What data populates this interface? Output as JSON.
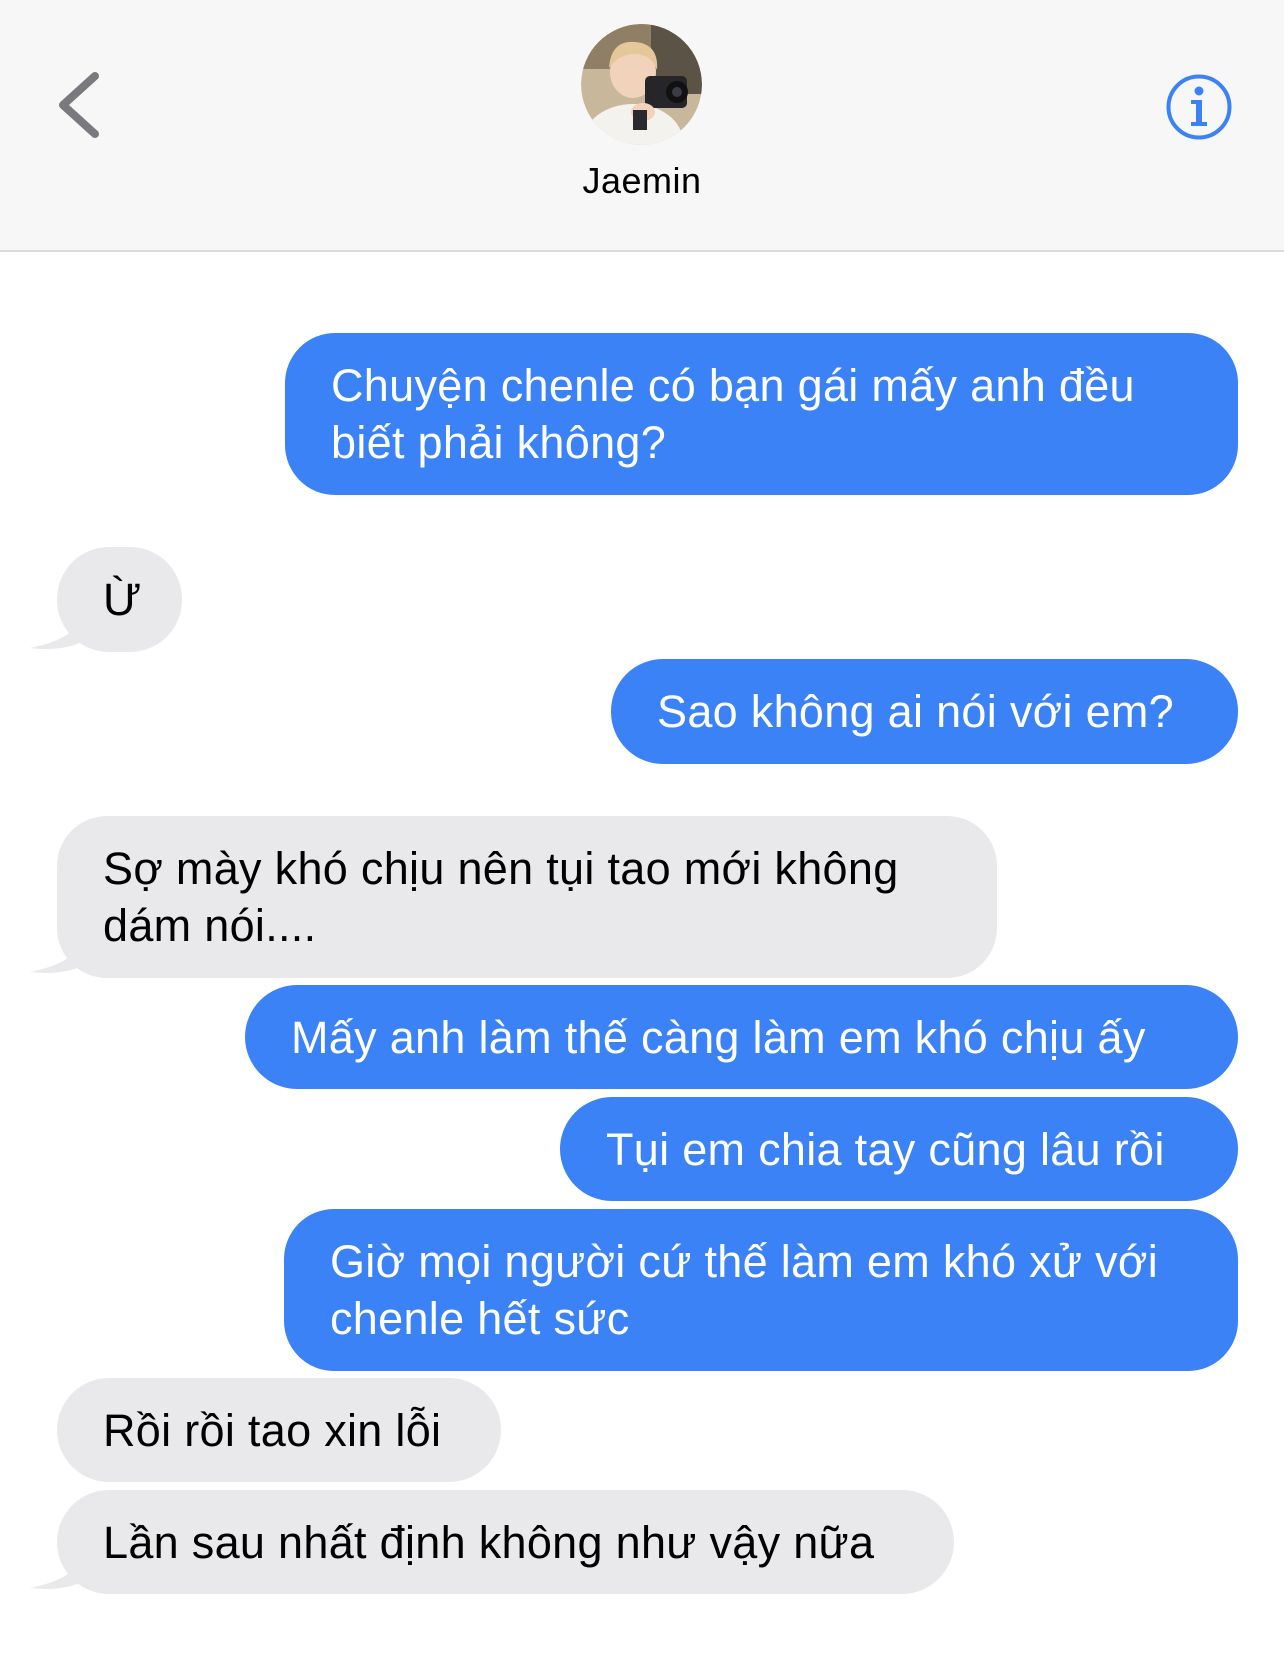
{
  "header": {
    "contact_name": "Jaemin",
    "back_icon": "chevron-left-icon",
    "info_icon": "info-circle-icon",
    "accent_color": "#3a82f6"
  },
  "conversation": {
    "messages": [
      {
        "direction": "sent",
        "text": "Chuyện chenle có bạn gái mấy anh đều\nbiết phải không?"
      },
      {
        "direction": "received",
        "text": "Ừ"
      },
      {
        "direction": "sent",
        "text": "Sao không ai nói với em?"
      },
      {
        "direction": "received",
        "text": "Sợ mày khó chịu nên tụi tao mới không\ndám nói...."
      },
      {
        "direction": "sent",
        "text": "Mấy anh làm thế càng làm em khó chịu ấy"
      },
      {
        "direction": "sent",
        "text": "Tụi em chia tay cũng lâu rồi"
      },
      {
        "direction": "sent",
        "text": "Giờ mọi người cứ thế làm em khó xử với\nchenle hết sức"
      },
      {
        "direction": "received",
        "text": "Rồi rồi tao xin lỗi"
      },
      {
        "direction": "received",
        "text": "Lần sau nhất định không như vậy nữa"
      }
    ]
  }
}
